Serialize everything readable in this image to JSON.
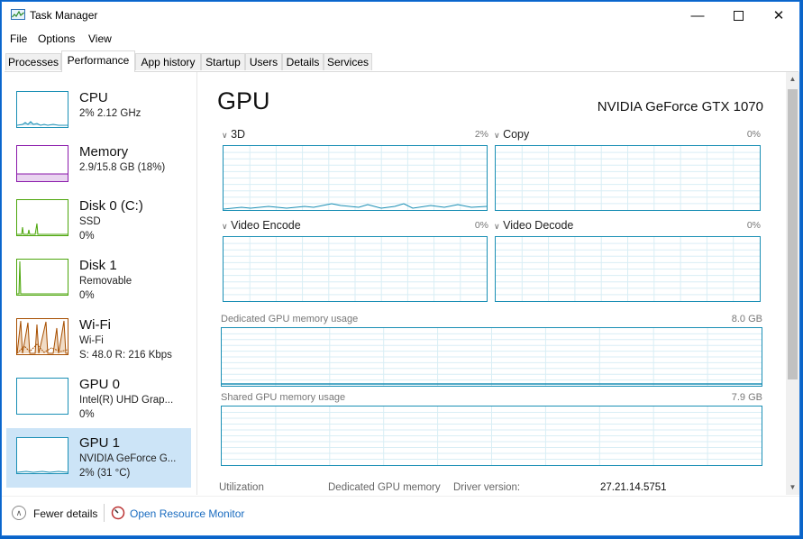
{
  "window": {
    "title": "Task Manager",
    "minimize_icon": "minimize-icon",
    "maximize_icon": "maximize-icon",
    "close_icon": "close-icon"
  },
  "menu": [
    "File",
    "Options",
    "View"
  ],
  "tabs": [
    "Processes",
    "Performance",
    "App history",
    "Startup",
    "Users",
    "Details",
    "Services"
  ],
  "active_tab": "Performance",
  "sidebar": [
    {
      "name": "CPU",
      "line1": "2% 2.12 GHz",
      "line2": "",
      "color": "#1a8fb5"
    },
    {
      "name": "Memory",
      "line1": "2.9/15.8 GB (18%)",
      "line2": "",
      "color": "#8b1aab"
    },
    {
      "name": "Disk 0 (C:)",
      "line1": "SSD",
      "line2": "0%",
      "color": "#4da60c"
    },
    {
      "name": "Disk 1",
      "line1": "Removable",
      "line2": "0%",
      "color": "#4da60c"
    },
    {
      "name": "Wi-Fi",
      "line1": "Wi-Fi",
      "line2": "S: 48.0  R: 216 Kbps",
      "color": "#a74f01"
    },
    {
      "name": "GPU 0",
      "line1": "Intel(R) UHD Grap...",
      "line2": "0%",
      "color": "#1a8fb5"
    },
    {
      "name": "GPU 1",
      "line1": "NVIDIA GeForce G...",
      "line2": "2% (31 °C)",
      "color": "#1a8fb5",
      "selected": true
    }
  ],
  "main": {
    "title": "GPU",
    "model": "NVIDIA GeForce GTX 1070",
    "engines": [
      {
        "label": "3D",
        "pct": "2%"
      },
      {
        "label": "Copy",
        "pct": "0%"
      },
      {
        "label": "Video Encode",
        "pct": "0%"
      },
      {
        "label": "Video Decode",
        "pct": "0%"
      }
    ],
    "dedicated_label": "Dedicated GPU memory usage",
    "dedicated_max": "8.0 GB",
    "shared_label": "Shared GPU memory usage",
    "shared_max": "7.9 GB",
    "stats": {
      "utilization": "Utilization",
      "dedicated_memory": "Dedicated GPU memory",
      "driver_version_label": "Driver version:",
      "driver_version": "27.21.14.5751"
    }
  },
  "footer": {
    "fewer_details": "Fewer details",
    "open_resource_monitor": "Open Resource Monitor"
  },
  "colors": {
    "accent": "#1a8fb5",
    "selected_bg": "#cce4f7",
    "link": "#1a6cc0"
  }
}
